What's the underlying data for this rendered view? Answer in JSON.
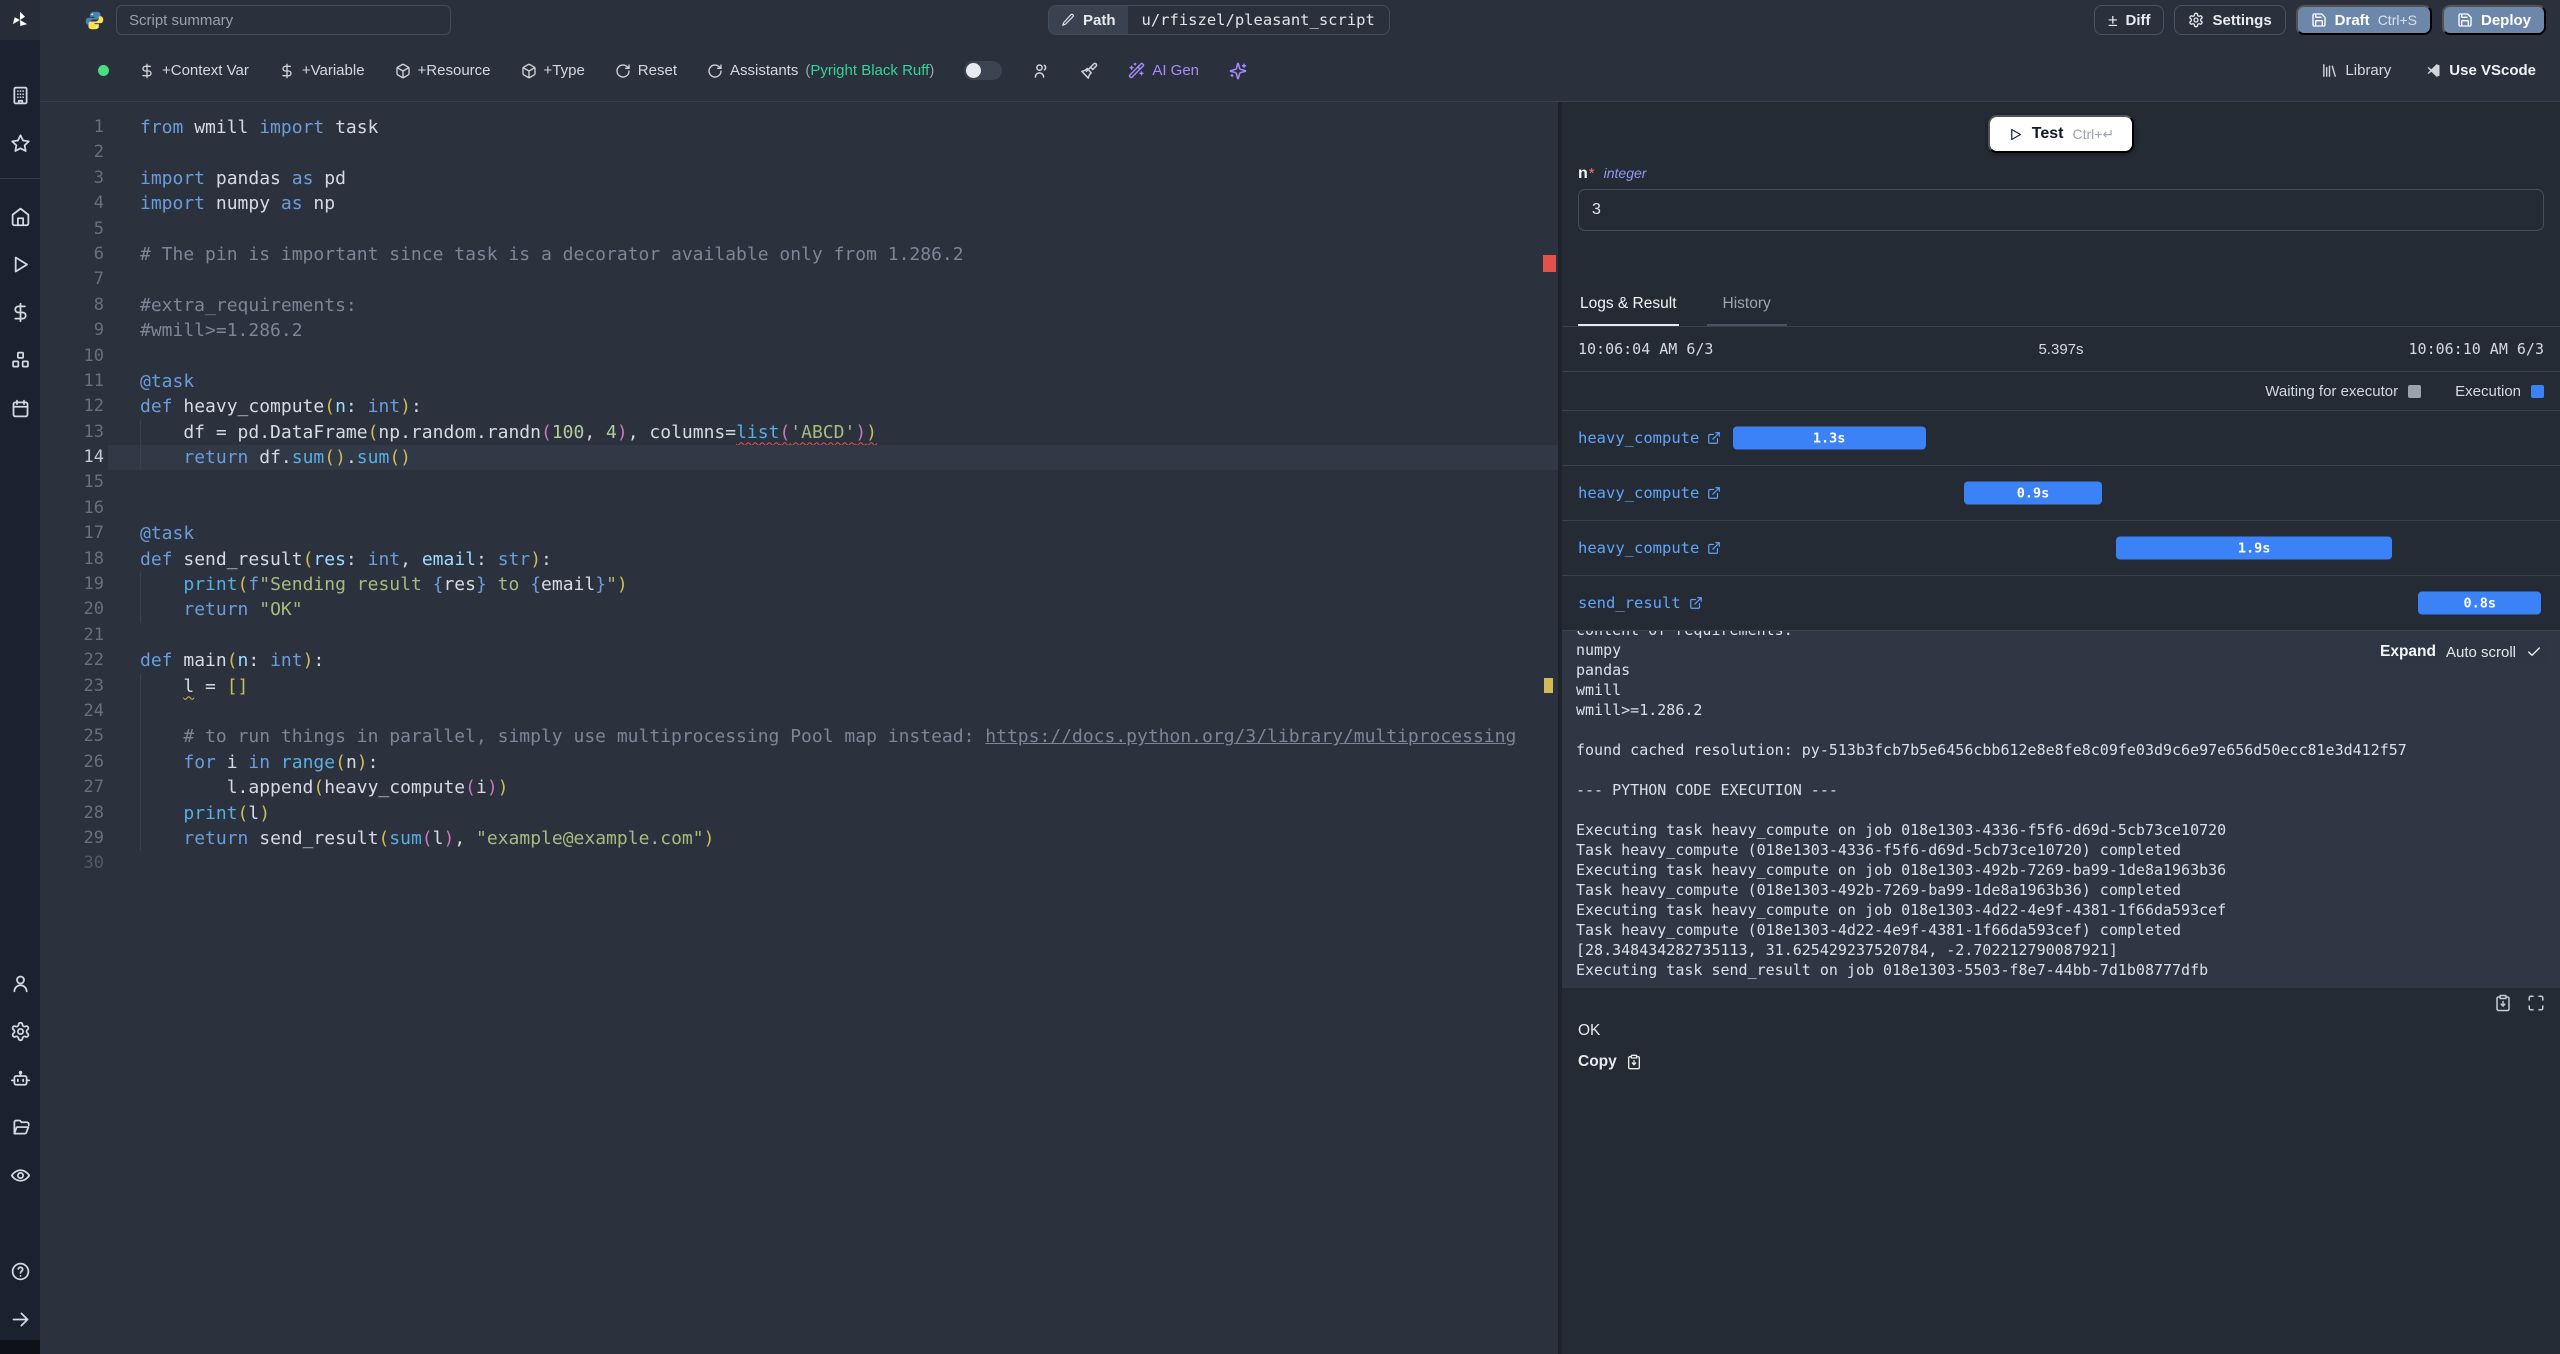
{
  "colors": {
    "accent_execution": "#3b82f6",
    "accent_waiting": "#9ca3af",
    "link_blue": "#60a5fa",
    "button_blue": "#6d87ab",
    "success_green": "#4ade80",
    "assistant_green": "#34d399",
    "ai_purple": "#a78bfa"
  },
  "topbar": {
    "summary_placeholder": "Script summary",
    "path_label": "Path",
    "path_value": "u/rfiszel/pleasant_script",
    "diff_label": "Diff",
    "settings_label": "Settings",
    "draft_label": "Draft",
    "draft_shortcut": "Ctrl+S",
    "deploy_label": "Deploy"
  },
  "toolbar": {
    "context_var": "+Context Var",
    "variable": "+Variable",
    "resource": "+Resource",
    "type": "+Type",
    "reset": "Reset",
    "assistants": "Assistants",
    "assistants_open": "(",
    "assistants_langs": [
      "Pyright",
      "Black",
      "Ruff"
    ],
    "assistants_close": ")",
    "ai_gen": "AI Gen",
    "library": "Library",
    "use_vscode": "Use VScode"
  },
  "editor": {
    "language": "python",
    "lines": [
      {
        "n": 1,
        "t": [
          [
            "kw",
            "from"
          ],
          [
            "pl",
            " wmill "
          ],
          [
            "kw",
            "import"
          ],
          [
            "pl",
            " task"
          ]
        ]
      },
      {
        "n": 2,
        "t": []
      },
      {
        "n": 3,
        "t": [
          [
            "kw",
            "import"
          ],
          [
            "pl",
            " pandas "
          ],
          [
            "kw",
            "as"
          ],
          [
            "pl",
            " pd"
          ]
        ]
      },
      {
        "n": 4,
        "t": [
          [
            "kw",
            "import"
          ],
          [
            "pl",
            " numpy "
          ],
          [
            "kw",
            "as"
          ],
          [
            "pl",
            " np"
          ]
        ]
      },
      {
        "n": 5,
        "t": []
      },
      {
        "n": 6,
        "t": [
          [
            "com",
            "# The pin is important since task is a decorator available only from 1.286.2"
          ]
        ]
      },
      {
        "n": 7,
        "t": []
      },
      {
        "n": 8,
        "t": [
          [
            "com",
            "#extra_requirements:"
          ]
        ]
      },
      {
        "n": 9,
        "t": [
          [
            "com",
            "#wmill>=1.286.2"
          ]
        ]
      },
      {
        "n": 10,
        "t": []
      },
      {
        "n": 11,
        "t": [
          [
            "dec",
            "@task"
          ]
        ]
      },
      {
        "n": 12,
        "t": [
          [
            "kw",
            "def"
          ],
          [
            "pl",
            " heavy_compute"
          ],
          [
            "p1",
            "("
          ],
          [
            "param",
            "n"
          ],
          [
            "pl",
            ": "
          ],
          [
            "type",
            "int"
          ],
          [
            "p1",
            ")"
          ],
          [
            "pl",
            ":"
          ]
        ]
      },
      {
        "n": 13,
        "g": true,
        "t": [
          [
            "pl",
            "    df = pd.DataFrame"
          ],
          [
            "p1",
            "("
          ],
          [
            "pl",
            "np.random.randn"
          ],
          [
            "p2",
            "("
          ],
          [
            "num",
            "100"
          ],
          [
            "pl",
            ", "
          ],
          [
            "num",
            "4"
          ],
          [
            "p2",
            ")"
          ],
          [
            "pl",
            ", columns="
          ],
          [
            "bi err",
            "list"
          ],
          [
            "p2 err",
            "("
          ],
          [
            "str err",
            "'ABCD'"
          ],
          [
            "p2 err",
            ")"
          ],
          [
            "p1 err",
            ")"
          ]
        ]
      },
      {
        "n": 14,
        "g": true,
        "cur": true,
        "t": [
          [
            "pl",
            "    "
          ],
          [
            "kw",
            "return"
          ],
          [
            "pl",
            " df."
          ],
          [
            "bi",
            "sum"
          ],
          [
            "p1",
            "()"
          ],
          [
            "pl",
            "."
          ],
          [
            "bi",
            "sum"
          ],
          [
            "p1",
            "()"
          ]
        ]
      },
      {
        "n": 15,
        "t": []
      },
      {
        "n": 16,
        "t": []
      },
      {
        "n": 17,
        "t": [
          [
            "dec",
            "@task"
          ]
        ]
      },
      {
        "n": 18,
        "t": [
          [
            "kw",
            "def"
          ],
          [
            "pl",
            " send_result"
          ],
          [
            "p1",
            "("
          ],
          [
            "param",
            "res"
          ],
          [
            "pl",
            ": "
          ],
          [
            "type",
            "int"
          ],
          [
            "pl",
            ", "
          ],
          [
            "param",
            "email"
          ],
          [
            "pl",
            ": "
          ],
          [
            "type",
            "str"
          ],
          [
            "p1",
            ")"
          ],
          [
            "pl",
            ":"
          ]
        ]
      },
      {
        "n": 19,
        "g": true,
        "t": [
          [
            "pl",
            "    "
          ],
          [
            "bi",
            "print"
          ],
          [
            "p1",
            "("
          ],
          [
            "kw",
            "f"
          ],
          [
            "str",
            "\"Sending result "
          ],
          [
            "p3",
            "{"
          ],
          [
            "pl",
            "res"
          ],
          [
            "p3",
            "}"
          ],
          [
            "str",
            " to "
          ],
          [
            "p3",
            "{"
          ],
          [
            "pl",
            "email"
          ],
          [
            "p3",
            "}"
          ],
          [
            "str",
            "\""
          ],
          [
            "p1",
            ")"
          ]
        ]
      },
      {
        "n": 20,
        "g": true,
        "t": [
          [
            "pl",
            "    "
          ],
          [
            "kw",
            "return"
          ],
          [
            "pl",
            " "
          ],
          [
            "str",
            "\"OK\""
          ]
        ]
      },
      {
        "n": 21,
        "t": []
      },
      {
        "n": 22,
        "t": [
          [
            "kw",
            "def"
          ],
          [
            "pl",
            " main"
          ],
          [
            "p1",
            "("
          ],
          [
            "param",
            "n"
          ],
          [
            "pl",
            ": "
          ],
          [
            "type",
            "int"
          ],
          [
            "p1",
            ")"
          ],
          [
            "pl",
            ":"
          ]
        ]
      },
      {
        "n": 23,
        "g": true,
        "t": [
          [
            "pl",
            "    "
          ],
          [
            "pl warn",
            "l"
          ],
          [
            "pl",
            " = "
          ],
          [
            "p1",
            "[]"
          ]
        ]
      },
      {
        "n": 24,
        "g": true,
        "t": []
      },
      {
        "n": 25,
        "g": true,
        "t": [
          [
            "com",
            "    # to run things in parallel, simply use multiprocessing Pool map instead: "
          ],
          [
            "comlink",
            "https://docs.python.org/3/library/multiprocessing"
          ]
        ]
      },
      {
        "n": 26,
        "g": true,
        "t": [
          [
            "pl",
            "    "
          ],
          [
            "kw",
            "for"
          ],
          [
            "pl",
            " i "
          ],
          [
            "kw",
            "in"
          ],
          [
            "pl",
            " "
          ],
          [
            "bi",
            "range"
          ],
          [
            "p1",
            "("
          ],
          [
            "pl",
            "n"
          ],
          [
            "p1",
            ")"
          ],
          [
            "pl",
            ":"
          ]
        ]
      },
      {
        "n": 27,
        "g": true,
        "t": [
          [
            "pl",
            "        l.append"
          ],
          [
            "p1",
            "("
          ],
          [
            "pl",
            "heavy_compute"
          ],
          [
            "p2",
            "("
          ],
          [
            "pl",
            "i"
          ],
          [
            "p2",
            ")"
          ],
          [
            "p1",
            ")"
          ]
        ]
      },
      {
        "n": 28,
        "g": true,
        "t": [
          [
            "pl",
            "    "
          ],
          [
            "bi",
            "print"
          ],
          [
            "p1",
            "("
          ],
          [
            "pl",
            "l"
          ],
          [
            "p1",
            ")"
          ]
        ]
      },
      {
        "n": 29,
        "g": true,
        "t": [
          [
            "pl",
            "    "
          ],
          [
            "kw",
            "return"
          ],
          [
            "pl",
            " send_result"
          ],
          [
            "p1",
            "("
          ],
          [
            "bi",
            "sum"
          ],
          [
            "p2",
            "("
          ],
          [
            "pl",
            "l"
          ],
          [
            "p2",
            ")"
          ],
          [
            "pl",
            ", "
          ],
          [
            "str",
            "\"example@example.com\""
          ],
          [
            "p1",
            ")"
          ]
        ]
      },
      {
        "n": 30,
        "dim": true,
        "t": []
      }
    ]
  },
  "run_panel": {
    "test_label": "Test",
    "test_shortcut": "Ctrl+↵",
    "arg": {
      "name": "n",
      "required": "*",
      "type": "integer",
      "value": "3"
    },
    "tabs": [
      "Logs & Result",
      "History"
    ],
    "started_at": "10:06:04 AM 6/3",
    "duration": "5.397s",
    "ended_at": "10:06:10 AM 6/3",
    "legend": {
      "waiting": "Waiting for executor",
      "execution": "Execution"
    },
    "timeline": [
      {
        "label": "heavy_compute",
        "duration": "1.3s",
        "offset_pct": 16.0,
        "width_pct": 20.0
      },
      {
        "label": "heavy_compute",
        "duration": "0.9s",
        "offset_pct": 40.0,
        "width_pct": 14.2
      },
      {
        "label": "heavy_compute",
        "duration": "1.9s",
        "offset_pct": 55.7,
        "width_pct": 28.6
      },
      {
        "label": "send_result",
        "duration": "0.8s",
        "offset_pct": 87.0,
        "width_pct": 12.7
      }
    ],
    "logs": {
      "expand_label": "Expand",
      "autoscroll_label": "Auto scroll",
      "lines": [
        "content of requirements:",
        "numpy",
        "pandas",
        "wmill",
        "wmill>=1.286.2",
        "",
        "found cached resolution: py-513b3fcb7b5e6456cbb612e8e8fe8c09fe03d9c6e97e656d50ecc81e3d412f57",
        "",
        "--- PYTHON CODE EXECUTION ---",
        "",
        "Executing task heavy_compute on job 018e1303-4336-f5f6-d69d-5cb73ce10720",
        "Task heavy_compute (018e1303-4336-f5f6-d69d-5cb73ce10720) completed",
        "Executing task heavy_compute on job 018e1303-492b-7269-ba99-1de8a1963b36",
        "Task heavy_compute (018e1303-492b-7269-ba99-1de8a1963b36) completed",
        "Executing task heavy_compute on job 018e1303-4d22-4e9f-4381-1f66da593cef",
        "Task heavy_compute (018e1303-4d22-4e9f-4381-1f66da593cef) completed",
        "[28.348434282735113, 31.625429237520784, -2.702212790087921]",
        "Executing task send_result on job 018e1303-5503-f8e7-44bb-7d1b08777dfb"
      ]
    },
    "result": {
      "value": "OK",
      "copy_label": "Copy"
    }
  }
}
